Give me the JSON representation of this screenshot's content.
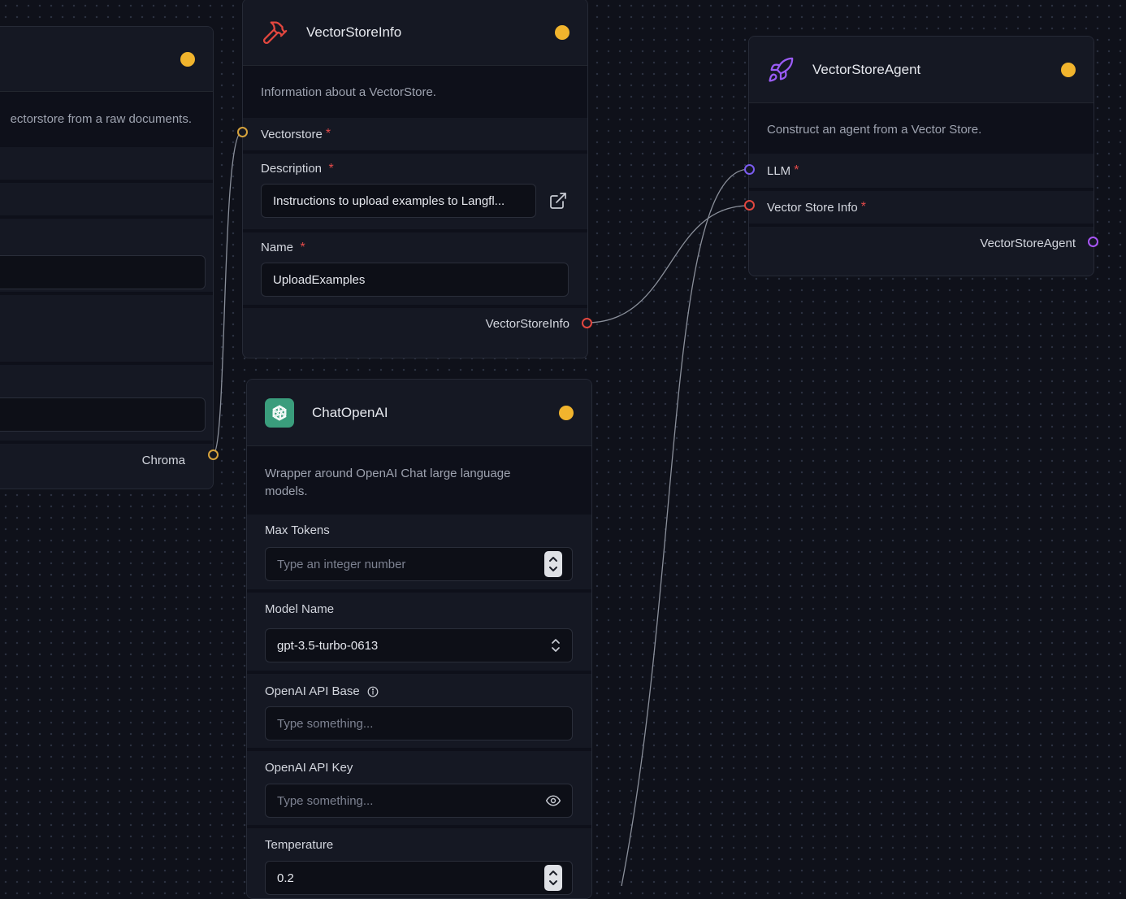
{
  "left_node": {
    "description_fragment": "ectorstore from a raw documents.",
    "output_label": "Chroma",
    "partial_field_text": "..."
  },
  "vector_store_info": {
    "title": "VectorStoreInfo",
    "description": "Information about a VectorStore.",
    "vectorstore_label": "Vectorstore",
    "description_label": "Description",
    "description_value": "Instructions to upload examples to Langfl...",
    "name_label": "Name",
    "name_value": "UploadExamples",
    "output_label": "VectorStoreInfo",
    "icon": "hammer-icon"
  },
  "vector_store_agent": {
    "title": "VectorStoreAgent",
    "description": "Construct an agent from a Vector Store.",
    "llm_label": "LLM",
    "vsi_label": "Vector Store Info",
    "output_label": "VectorStoreAgent",
    "icon": "rocket-icon"
  },
  "chat_openai": {
    "title": "ChatOpenAI",
    "description": "Wrapper around OpenAI Chat large language models.",
    "max_tokens_label": "Max Tokens",
    "max_tokens_placeholder": "Type an integer number",
    "model_name_label": "Model Name",
    "model_name_value": "gpt-3.5-turbo-0613",
    "api_base_label": "OpenAI API Base",
    "api_base_placeholder": "Type something...",
    "api_key_label": "OpenAI API Key",
    "api_key_placeholder": "Type something...",
    "temperature_label": "Temperature",
    "temperature_value": "0.2",
    "icon": "openai-icon"
  },
  "required_marker": "*",
  "colors": {
    "status": "#f1b42d",
    "chroma_handle": "#d7a33c",
    "vsi_handle": "#e2473f",
    "llm_handle": "#7b5cf0",
    "agent_handle": "#a855f7",
    "edge": "#9aa0ab"
  }
}
